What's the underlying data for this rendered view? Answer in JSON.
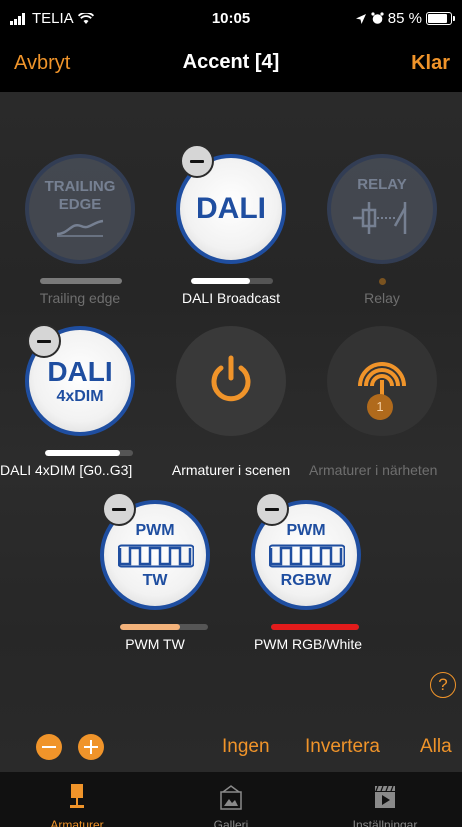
{
  "status": {
    "carrier": "TELIA",
    "time": "10:05",
    "battery": "85 %"
  },
  "nav": {
    "cancel": "Avbryt",
    "title": "Accent [4]",
    "done": "Klar"
  },
  "fixtures": {
    "trailing": {
      "line1": "TRAILING",
      "line2": "EDGE",
      "label": "Trailing edge",
      "level": 1.0
    },
    "dali": {
      "text": "DALI",
      "label": "DALI Broadcast",
      "level": 0.72
    },
    "relay": {
      "text": "RELAY",
      "label": "Relay"
    },
    "dali4x": {
      "line1": "DALI",
      "line2": "4xDIM",
      "label": "DALI 4xDIM [G0..G3]",
      "level": 0.85
    },
    "scene": {
      "label": "Armaturer i scenen"
    },
    "nearby": {
      "label": "Armaturer i närheten",
      "badge": "1"
    },
    "pwmtw": {
      "line1": "PWM",
      "line2": "TW",
      "label": "PWM TW",
      "level": 0.68
    },
    "pwmrgbw": {
      "line1": "PWM",
      "line2": "RGBW",
      "label": "PWM RGB/White",
      "level": 1.0
    }
  },
  "help": "?",
  "actions": {
    "none": "Ingen",
    "invert": "Invertera",
    "all": "Alla"
  },
  "tabs": [
    {
      "label": "Armaturer"
    },
    {
      "label": "Galleri"
    },
    {
      "label": "Inställningar"
    }
  ],
  "colors": {
    "accent": "#f0942a",
    "dali_blue": "#1f4ea0",
    "rgbw_bar": "#e31b1b",
    "tw_bar": "#f3b27a"
  }
}
